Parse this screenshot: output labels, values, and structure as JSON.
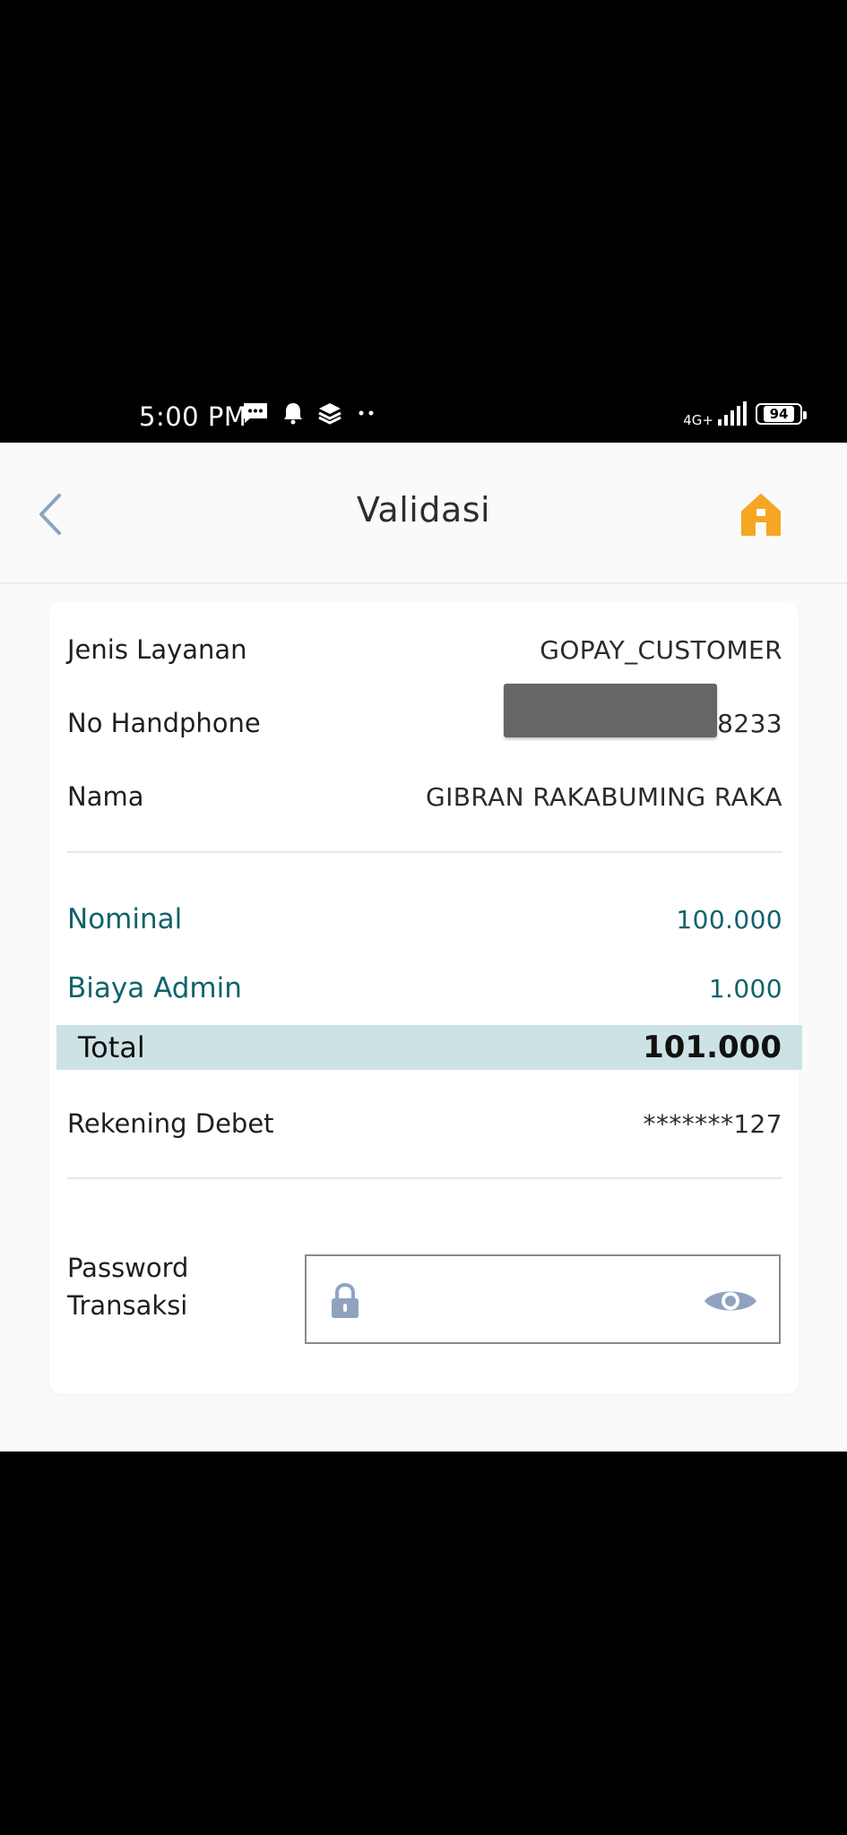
{
  "status_bar": {
    "time": "5:00 PM",
    "network": "4G+",
    "battery": "94",
    "icons": [
      "message-icon",
      "notification-icon",
      "layers-icon",
      "more-dots-icon",
      "signal-icon",
      "battery-icon"
    ]
  },
  "header": {
    "title": "Validasi",
    "back_icon": "chevron-left-icon",
    "home_icon": "home-icon",
    "home_color": "#f5a623"
  },
  "details": {
    "jenis_layanan": {
      "label": "Jenis Layanan",
      "value": "GOPAY_CUSTOMER"
    },
    "no_handphone": {
      "label": "No Handphone",
      "value": "8233"
    },
    "nama": {
      "label": "Nama",
      "value": "GIBRAN RAKABUMING RAKA"
    }
  },
  "amounts": {
    "nominal": {
      "label": "Nominal",
      "value": "100.000"
    },
    "biaya_admin": {
      "label": "Biaya Admin",
      "value": "1.000"
    },
    "total": {
      "label": "Total",
      "value": "101.000"
    },
    "rekening_debet": {
      "label": "Rekening Debet",
      "value": "*******127"
    }
  },
  "password": {
    "label_line1": "Password",
    "label_line2": "Transaksi",
    "value": "",
    "lock_icon": "lock-icon",
    "toggle_icon": "eye-icon"
  },
  "colors": {
    "accent_teal": "#11636c",
    "total_band": "#cde2e4",
    "icon_gray": "#8fa3c0"
  }
}
